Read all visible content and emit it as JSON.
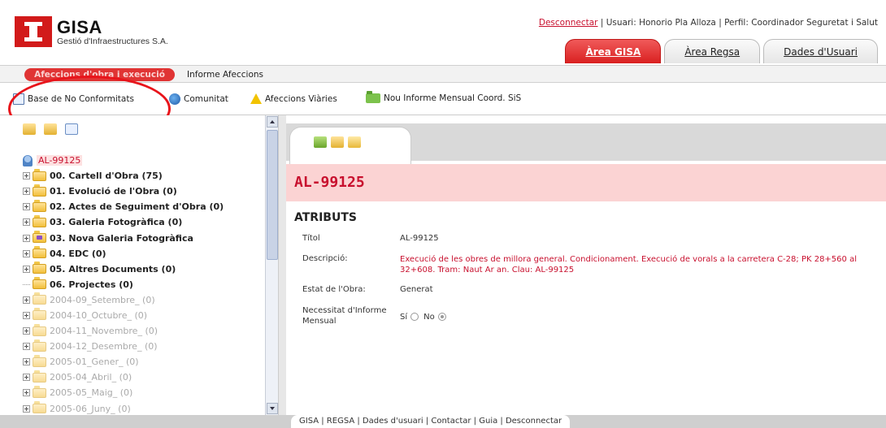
{
  "header": {
    "brand": "GISA",
    "brand_sub": "Gestió d'Infraestructures S.A.",
    "disconnect": "Desconnectar",
    "user_info": " | Usuari: Honorio Pla Alloza | Perfil: Coordinador Seguretat i Salut",
    "tabs": [
      {
        "label": "Àrea GISA",
        "active": true
      },
      {
        "label": "Àrea Regsa",
        "active": false
      },
      {
        "label": "Dades d'Usuari",
        "active": false
      }
    ]
  },
  "subnav": {
    "active": "Afeccions d'obra i execució",
    "other": "Informe Afeccions"
  },
  "toolbar": {
    "items": [
      {
        "label": "Base de No Conformitats",
        "icon": "document-icon"
      },
      {
        "label": "Comunitat",
        "icon": "globe-icon"
      },
      {
        "label": "Afeccions Viàries",
        "icon": "warning-icon"
      },
      {
        "label": "Nou Informe Mensual Coord. SiS",
        "icon": "folder-add-icon"
      }
    ]
  },
  "tree": {
    "root": "AL-99125",
    "items": [
      {
        "label": "00. Cartell d'Obra (75)",
        "bold": true,
        "dim": false
      },
      {
        "label": "01. Evolució de l'Obra (0)",
        "bold": true,
        "dim": false
      },
      {
        "label": "02. Actes de Seguiment d'Obra (0)",
        "bold": true,
        "dim": false
      },
      {
        "label": "03. Galeria Fotogràfica (0)",
        "bold": true,
        "dim": false
      },
      {
        "label": "03. Nova Galeria Fotogràfica",
        "bold": true,
        "dim": false
      },
      {
        "label": "04. EDC (0)",
        "bold": true,
        "dim": false
      },
      {
        "label": "05. Altres Documents (0)",
        "bold": true,
        "dim": false
      },
      {
        "label": "06. Projectes (0)",
        "bold": true,
        "dim": false
      },
      {
        "label": "2004-09_Setembre_ (0)",
        "bold": false,
        "dim": true
      },
      {
        "label": "2004-10_Octubre_ (0)",
        "bold": false,
        "dim": true
      },
      {
        "label": "2004-11_Novembre_ (0)",
        "bold": false,
        "dim": true
      },
      {
        "label": "2004-12_Desembre_ (0)",
        "bold": false,
        "dim": true
      },
      {
        "label": "2005-01_Gener_ (0)",
        "bold": false,
        "dim": true
      },
      {
        "label": "2005-04_Abril_ (0)",
        "bold": false,
        "dim": true
      },
      {
        "label": "2005-05_Maig_ (0)",
        "bold": false,
        "dim": true
      },
      {
        "label": "2005-06_Juny_ (0)",
        "bold": false,
        "dim": true
      }
    ]
  },
  "detail": {
    "title": "AL-99125",
    "section": "ATRIBUTS",
    "attrs": {
      "titol_label": "Títol",
      "titol_value": "AL-99125",
      "descripcio_label": "Descripció:",
      "descripcio_value": "Execució de les obres de millora general. Condicionament. Execució de vorals a la carretera C-28; PK 28+560 al 32+608. Tram: Naut Ar an. Clau: AL-99125",
      "estat_label": "Estat de l'Obra:",
      "estat_value": "Generat",
      "necessitat_label_1": "Necessitat d'Informe",
      "necessitat_label_2": "Mensual",
      "opt_si": "Sí",
      "opt_no": "No"
    }
  },
  "footer": {
    "links": "GISA | REGSA | Dades d'usuari | Contactar | Guia | Desconnectar"
  },
  "colors": {
    "brand_red": "#c8102e",
    "annotation_red": "#e8141b",
    "title_band": "#fbd3d3"
  }
}
